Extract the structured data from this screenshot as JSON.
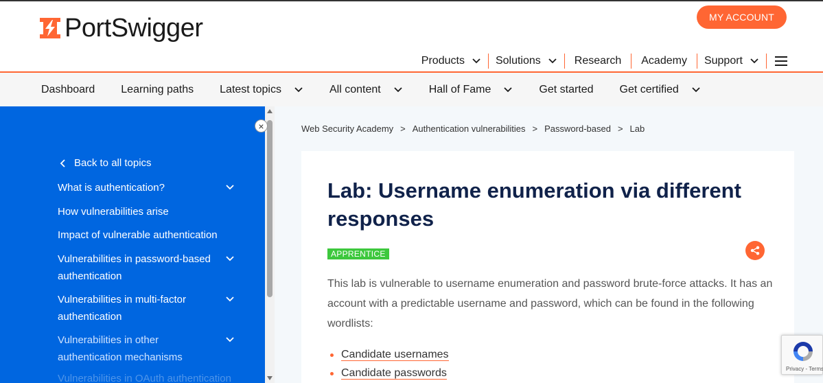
{
  "header": {
    "logo_text": "PortSwigger",
    "account_button": "MY ACCOUNT",
    "nav": [
      {
        "label": "Products",
        "has_dropdown": true
      },
      {
        "label": "Solutions",
        "has_dropdown": true
      },
      {
        "label": "Research",
        "has_dropdown": false
      },
      {
        "label": "Academy",
        "has_dropdown": false
      },
      {
        "label": "Support",
        "has_dropdown": true
      }
    ]
  },
  "subnav": [
    {
      "label": "Dashboard",
      "has_dropdown": false
    },
    {
      "label": "Learning paths",
      "has_dropdown": false
    },
    {
      "label": "Latest topics",
      "has_dropdown": true
    },
    {
      "label": "All content",
      "has_dropdown": true
    },
    {
      "label": "Hall of Fame",
      "has_dropdown": true
    },
    {
      "label": "Get started",
      "has_dropdown": false
    },
    {
      "label": "Get certified",
      "has_dropdown": true
    }
  ],
  "sidebar": {
    "close_symbol": "×",
    "back_label": "Back to all topics",
    "items": [
      {
        "label": "What is authentication?",
        "has_dropdown": true
      },
      {
        "label": "How vulnerabilities arise",
        "has_dropdown": false
      },
      {
        "label": "Impact of vulnerable authentication",
        "has_dropdown": false
      },
      {
        "label": "Vulnerabilities in password-based authentication",
        "has_dropdown": true
      },
      {
        "label": "Vulnerabilities in multi-factor authentication",
        "has_dropdown": true
      },
      {
        "label": "Vulnerabilities in other authentication mechanisms",
        "has_dropdown": true
      }
    ],
    "faded_item": "Vulnerabilities in OAuth authentication"
  },
  "breadcrumb": [
    "Web Security Academy",
    "Authentication vulnerabilities",
    "Password-based",
    "Lab"
  ],
  "breadcrumb_sep": ">",
  "lab": {
    "title": "Lab: Username enumeration via different responses",
    "level": "APPRENTICE",
    "description": "This lab is vulnerable to username enumeration and password brute-force attacks. It has an account with a predictable username and password, which can be found in the following wordlists:",
    "wordlists": [
      "Candidate usernames",
      "Candidate passwords"
    ]
  },
  "recaptcha": {
    "privacy": "Privacy",
    "terms": "Terms",
    "separator": " - "
  },
  "colors": {
    "brand_orange": "#ff6633",
    "sidebar_blue": "#0066e0",
    "title_navy": "#10224a",
    "badge_green": "#3dc83d"
  },
  "icons": {
    "logo": "portswigger-bolt-icon",
    "share": "share-icon",
    "menu": "hamburger-icon"
  }
}
